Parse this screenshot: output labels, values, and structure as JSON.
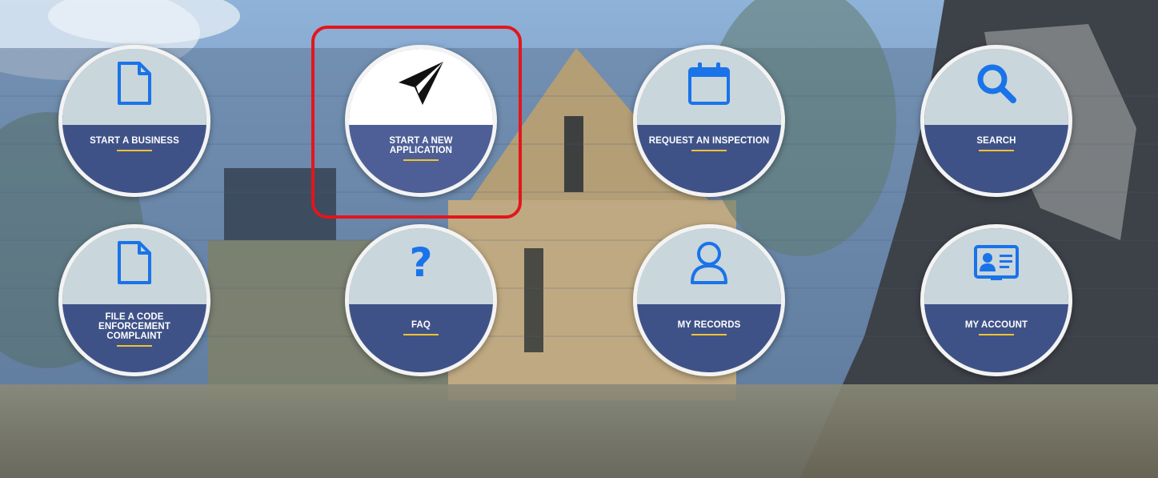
{
  "colors": {
    "tile_top": "#c9d6dc",
    "tile_bottom": "#3f5288",
    "underline": "#f1c232",
    "icon_blue": "#1a73e8",
    "highlight_border": "#e3161b"
  },
  "tiles": [
    {
      "label": "START A BUSINESS",
      "icon": "document-icon"
    },
    {
      "label": "START A NEW APPLICATION",
      "icon": "paper-plane-icon"
    },
    {
      "label": "REQUEST AN INSPECTION",
      "icon": "calendar-icon"
    },
    {
      "label": "SEARCH",
      "icon": "search-icon"
    },
    {
      "label": "FILE A CODE ENFORCEMENT COMPLAINT",
      "icon": "document-icon"
    },
    {
      "label": "FAQ",
      "icon": "question-mark-icon"
    },
    {
      "label": "MY RECORDS",
      "icon": "user-icon"
    },
    {
      "label": "MY ACCOUNT",
      "icon": "id-card-icon"
    }
  ],
  "highlighted_tile": "START A NEW APPLICATION"
}
